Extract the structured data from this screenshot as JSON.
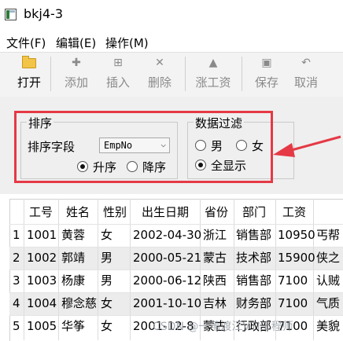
{
  "window": {
    "title": "bkj4-3"
  },
  "menu": [
    "文件(F)",
    "编辑(E)",
    "操作(M)"
  ],
  "toolbar": {
    "open": "打开",
    "add": "添加",
    "insert": "插入",
    "delete": "删除",
    "raise": "涨工资",
    "save": "保存",
    "cancel": "取消"
  },
  "sort": {
    "group_title": "排序",
    "field_label": "排序字段",
    "field_value": "EmpNo",
    "asc": "升序",
    "desc": "降序",
    "selected": "asc"
  },
  "filter": {
    "group_title": "数据过滤",
    "male": "男",
    "female": "女",
    "all": "全显示",
    "selected": "all"
  },
  "table": {
    "headers": [
      "工号",
      "姓名",
      "性别",
      "出生日期",
      "省份",
      "部门",
      "工资"
    ],
    "rows": [
      {
        "n": "1",
        "cells": [
          "1001",
          "黄蓉",
          "女",
          "2002-04-30",
          "浙江",
          "销售部",
          "10950",
          "丐帮"
        ]
      },
      {
        "n": "2",
        "cells": [
          "1002",
          "郭靖",
          "男",
          "2000-05-21",
          "蒙古",
          "技术部",
          "15900",
          "侠之"
        ]
      },
      {
        "n": "3",
        "cells": [
          "1003",
          "杨康",
          "男",
          "2000-06-12",
          "陕西",
          "销售部",
          "7100",
          "认贼"
        ]
      },
      {
        "n": "4",
        "cells": [
          "1004",
          "穆念慈",
          "女",
          "2001-10-10",
          "吉林",
          "财务部",
          "7100",
          "气质"
        ]
      },
      {
        "n": "5",
        "cells": [
          "1005",
          "华筝",
          "女",
          "2001-12-8",
          "蒙古",
          "行政部",
          "7100",
          "美貌"
        ]
      }
    ]
  },
  "watermark": "CSDN @一苇渡江VTI工程师",
  "colors": {
    "highlight": "#e53945"
  }
}
